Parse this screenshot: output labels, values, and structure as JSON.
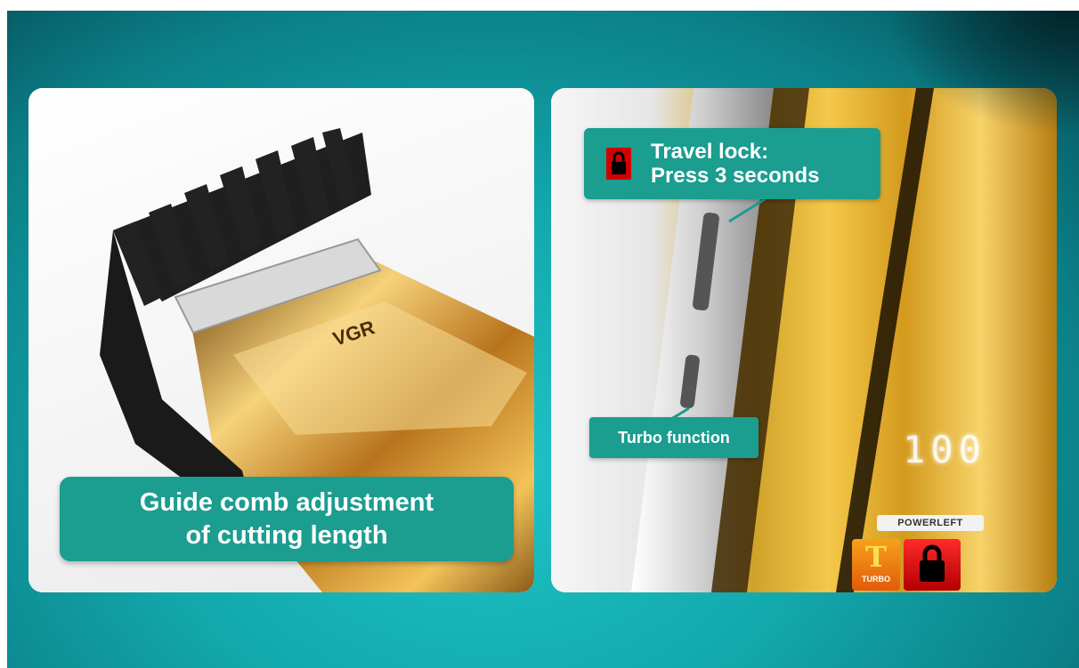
{
  "left_panel": {
    "brand_text": "VGR",
    "caption_line1": "Guide comb adjustment",
    "caption_line2": "of cutting length"
  },
  "right_panel": {
    "callout_lock_line1": "Travel lock:",
    "callout_lock_line2": "Press 3 seconds",
    "callout_turbo": "Turbo function",
    "display_digits": "100",
    "powerleft_label": "POWERLEFT",
    "turbo_badge_label": "TURBO",
    "turbo_badge_letter": "T"
  },
  "colors": {
    "teal_label": "#1b9d90",
    "background_teal": "#12a9ad",
    "gold": "#e3b23c"
  }
}
